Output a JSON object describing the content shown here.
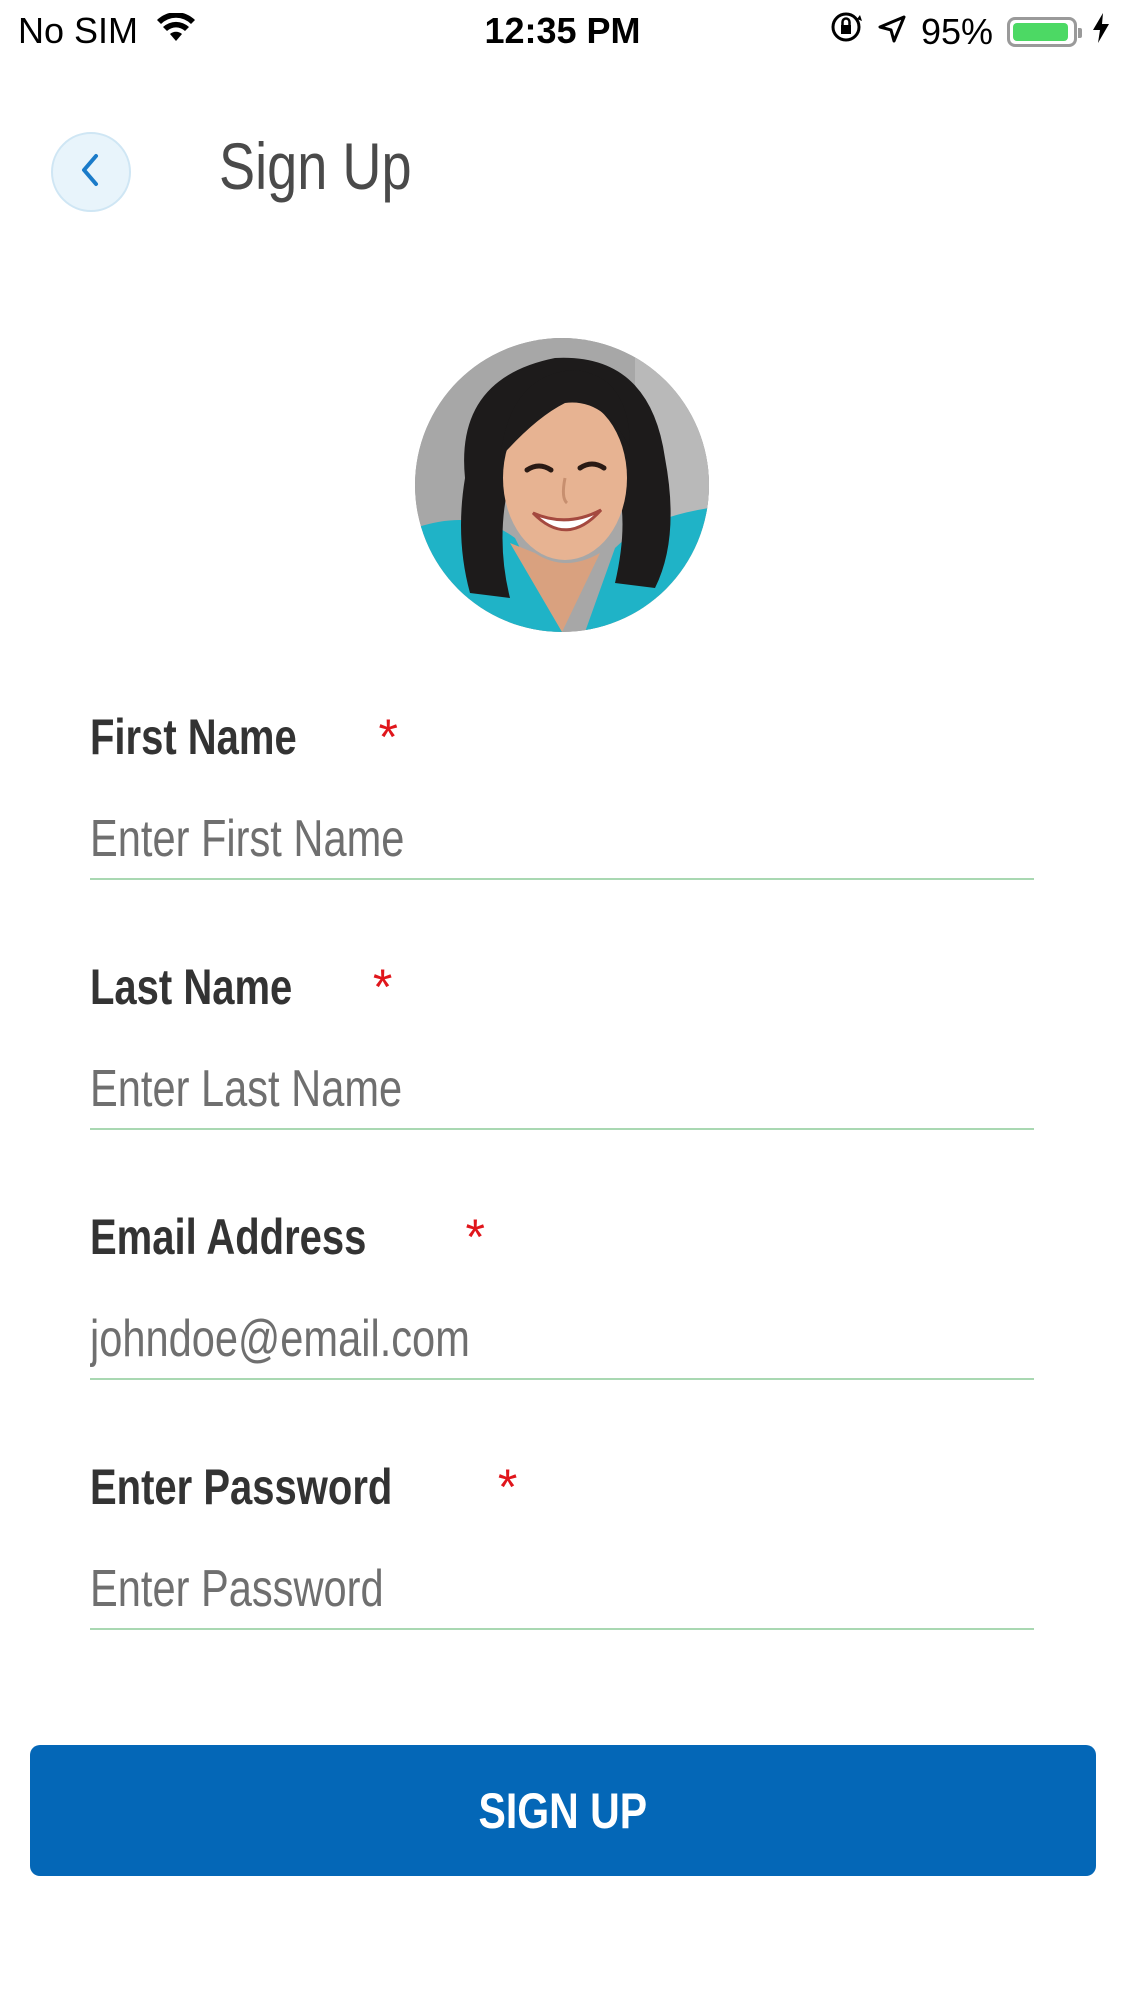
{
  "status_bar": {
    "carrier": "No SIM",
    "time": "12:35 PM",
    "battery_percent": "95%",
    "battery_level": 0.95,
    "icons": [
      "wifi-icon",
      "orientation-lock-icon",
      "location-arrow-icon",
      "battery-icon",
      "charging-bolt-icon"
    ]
  },
  "header": {
    "title": "Sign Up",
    "back_icon": "chevron-left-icon"
  },
  "avatar": {
    "icon": "profile-photo"
  },
  "form": {
    "required_marker": "*",
    "fields": [
      {
        "label": "First Name",
        "placeholder": "Enter First Name"
      },
      {
        "label": "Last Name",
        "placeholder": "Enter Last Name"
      },
      {
        "label": "Email Address",
        "placeholder": "johndoe@email.com"
      },
      {
        "label": "Enter Password",
        "placeholder": "Enter Password"
      }
    ]
  },
  "signup_button": {
    "label": "SIGN UP"
  },
  "colors": {
    "primary": "#0467b7",
    "required": "#e0161c",
    "input_underline": "#a9d8b2",
    "back_button_bg": "#e8f4fb",
    "battery": "#4cd964"
  }
}
